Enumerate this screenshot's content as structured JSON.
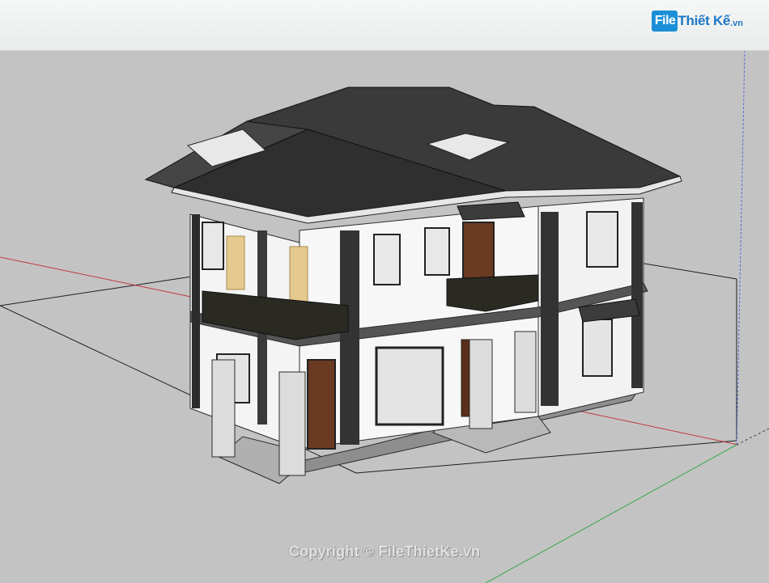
{
  "brand": {
    "badge": "File",
    "name": "Thiết Kế",
    "tld": ".vn"
  },
  "watermark": {
    "text": "Copyright © FileThietKe.vn"
  },
  "colors": {
    "background": "#c3c3c3",
    "roof": "#3a3a3a",
    "wall": "#f6f6f6",
    "trim": "#2b2b2b",
    "column": "#e6c98e",
    "door": "#6a3a22",
    "axis_red": "#c23a3a",
    "axis_green": "#36a84a",
    "axis_blue": "#5a6ad8"
  }
}
